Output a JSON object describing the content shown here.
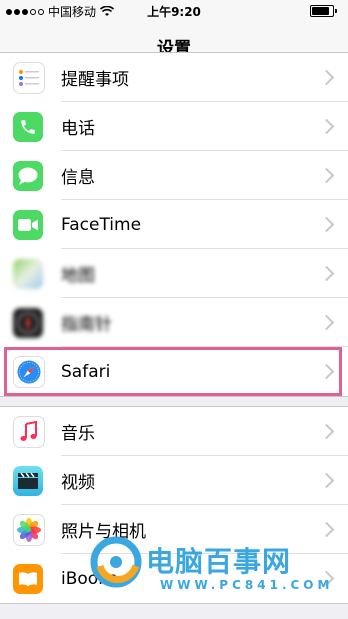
{
  "status_bar": {
    "carrier": "中国移动",
    "time": "上午9:20",
    "battery_percent": 85
  },
  "nav": {
    "title": "设置"
  },
  "group1": [
    {
      "label": "提醒事项",
      "icon": "reminders-icon"
    },
    {
      "label": "电话",
      "icon": "phone-icon"
    },
    {
      "label": "信息",
      "icon": "messages-icon"
    },
    {
      "label": "FaceTime",
      "icon": "facetime-icon"
    },
    {
      "label": "地图",
      "icon": "maps-icon"
    },
    {
      "label": "指南针",
      "icon": "compass-icon"
    },
    {
      "label": "Safari",
      "icon": "safari-icon"
    }
  ],
  "group2": [
    {
      "label": "音乐",
      "icon": "music-icon"
    },
    {
      "label": "视频",
      "icon": "videos-icon"
    },
    {
      "label": "照片与相机",
      "icon": "photos-icon"
    },
    {
      "label": "iBooks",
      "icon": "ibooks-icon"
    }
  ],
  "watermark": {
    "brand": "电脑百事网",
    "url": "WWW.PC841.COM"
  },
  "colors": {
    "highlight": "#e0609a",
    "brand": "#3aa7e0"
  }
}
